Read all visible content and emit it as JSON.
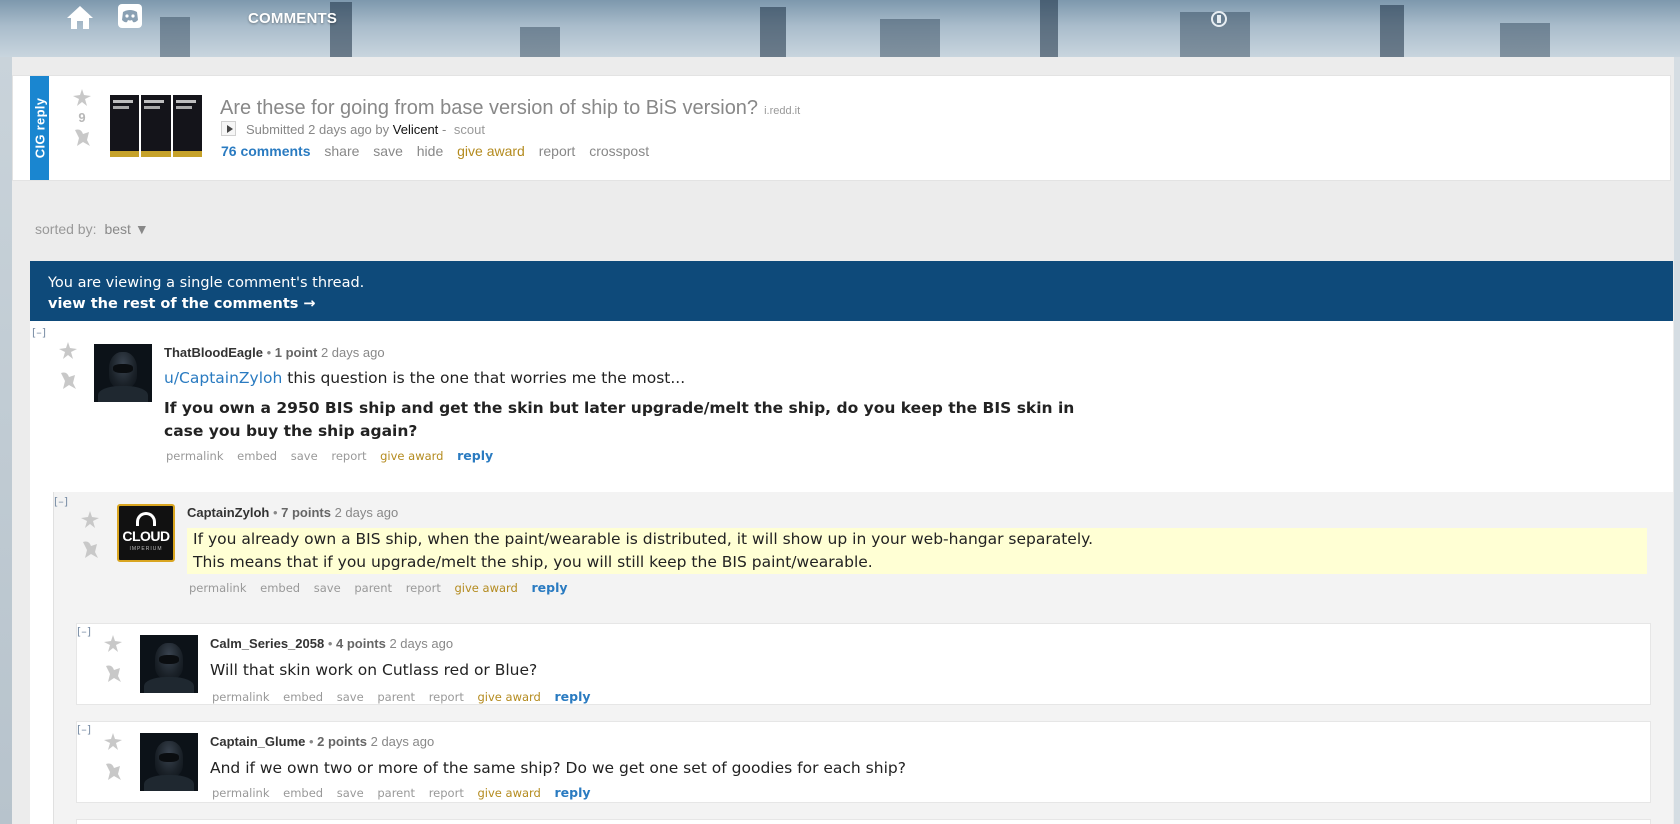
{
  "header": {
    "nav_label": "COMMENTS",
    "icons": [
      "home-icon",
      "discord-icon",
      "badge-icon"
    ]
  },
  "post": {
    "flair_tab": "CIG reply",
    "score": "9",
    "title": "Are these for going from base version of ship to BiS version?",
    "domain": "i.redd.it",
    "submitted": "Submitted",
    "time": "2 days ago",
    "by": "by",
    "author": "Velicent",
    "author_flair": "scout",
    "separator": "-",
    "buttons": {
      "comments": "76 comments",
      "share": "share",
      "save": "save",
      "hide": "hide",
      "give_award": "give award",
      "report": "report",
      "crosspost": "crosspost"
    }
  },
  "sort": {
    "label": "sorted by:",
    "value": "best ▼"
  },
  "banner": {
    "line1": "You are viewing a single comment's thread.",
    "line2": "view the rest of the comments →"
  },
  "collapse_label": "[–]",
  "comments": [
    {
      "author": "ThatBloodEagle",
      "score": "1 point",
      "time": "2 days ago",
      "mention": "u/CaptainZyloh",
      "text": " this question is the one that worries me the most...",
      "bold_line1": "If you own a 2950 BIS ship and get the skin but later upgrade/melt the ship, do you keep the BIS skin in",
      "bold_line2": "case you buy the ship again?",
      "actions": {
        "permalink": "permalink",
        "embed": "embed",
        "save": "save",
        "report": "report",
        "give_award": "give award",
        "reply": "reply"
      }
    },
    {
      "author": "CaptainZyloh",
      "score": "7 points",
      "time": "2 days ago",
      "avatar_text": "CLOUD",
      "avatar_sub": "IMPERIUM",
      "line1": "If you already own a BIS ship, when the paint/wearable is distributed, it will show up in your web-hangar separately.",
      "line2": "This means that if you upgrade/melt the ship, you will still keep the BIS paint/wearable.",
      "actions": {
        "permalink": "permalink",
        "embed": "embed",
        "save": "save",
        "parent": "parent",
        "report": "report",
        "give_award": "give award",
        "reply": "reply"
      }
    },
    {
      "author": "Calm_Series_2058",
      "score": "4 points",
      "time": "2 days ago",
      "text": "Will that skin work on Cutlass red or Blue?",
      "actions": {
        "permalink": "permalink",
        "embed": "embed",
        "save": "save",
        "parent": "parent",
        "report": "report",
        "give_award": "give award",
        "reply": "reply"
      }
    },
    {
      "author": "Captain_Glume",
      "score": "2 points",
      "time": "2 days ago",
      "text": "And if we own two or more of the same ship? Do we get one set of goodies for each ship?",
      "actions": {
        "permalink": "permalink",
        "embed": "embed",
        "save": "save",
        "parent": "parent",
        "report": "report",
        "give_award": "give award",
        "reply": "reply"
      }
    }
  ],
  "colors": {
    "banner": "#0e4a7a",
    "flair_tab": "#1a86d0",
    "link": "#2a7bc1",
    "award": "#b48b1f",
    "highlight": "#ffffd4"
  }
}
